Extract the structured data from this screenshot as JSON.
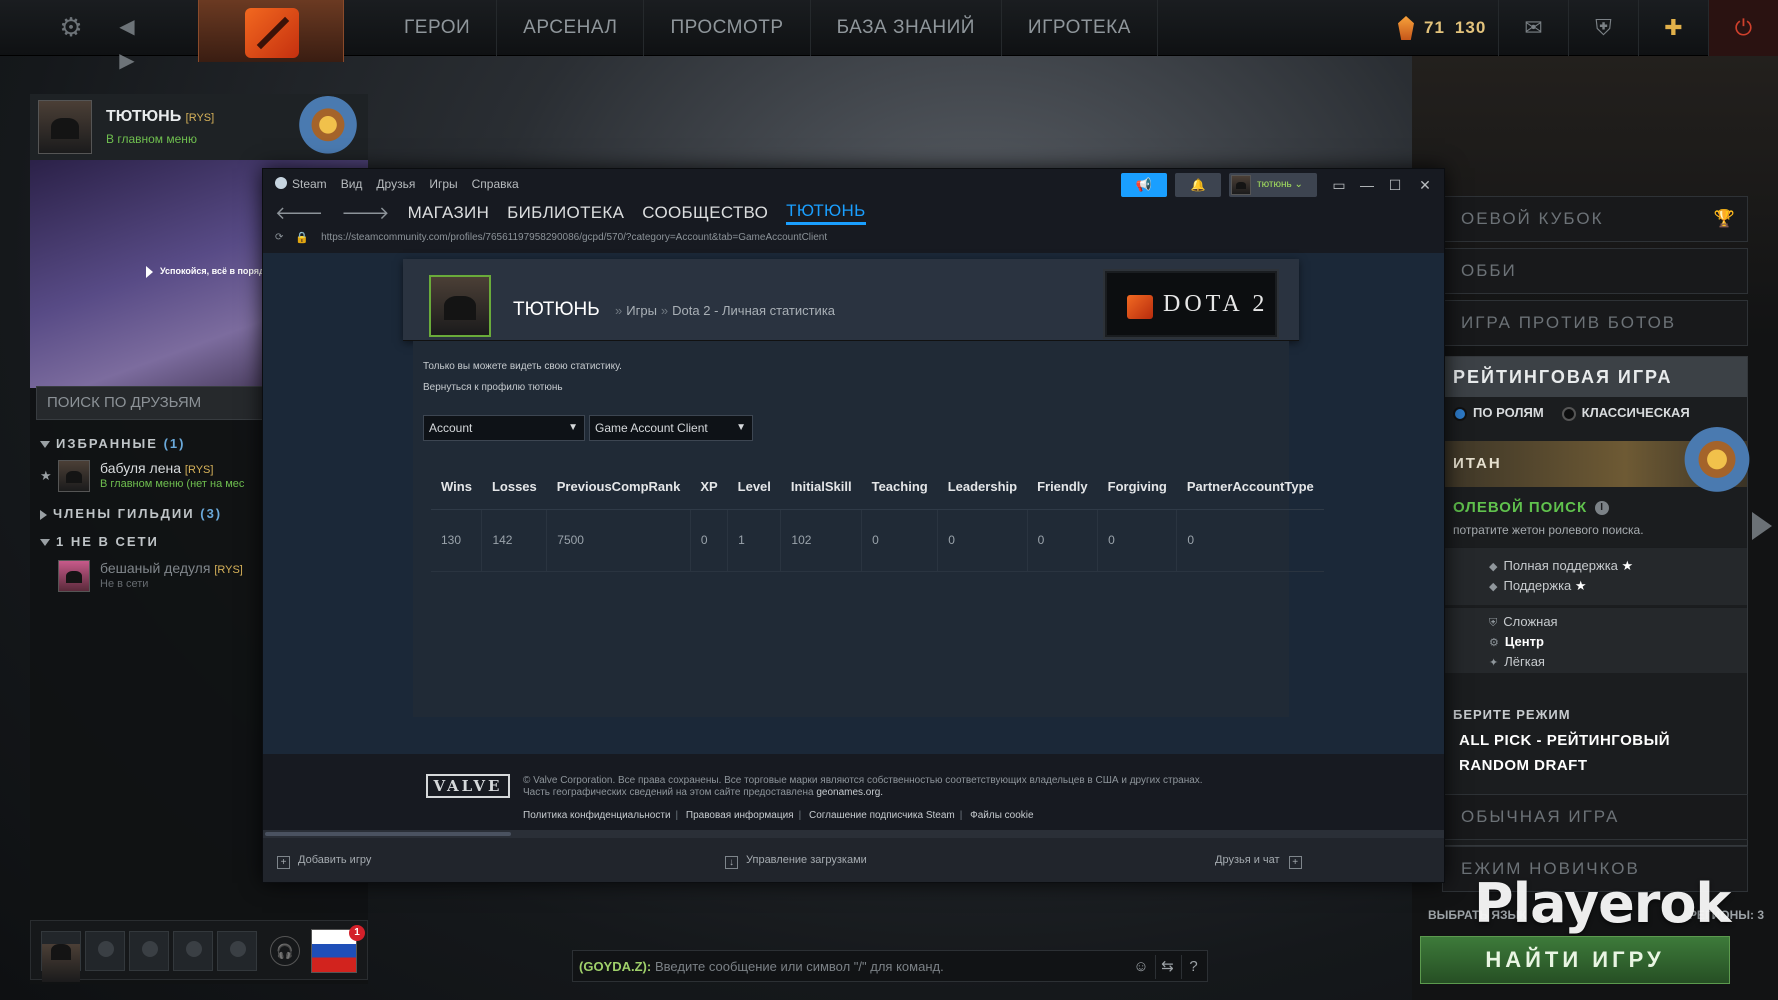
{
  "topbar": {
    "nav": [
      "ГЕРОИ",
      "АРСЕНАЛ",
      "ПРОСМОТР",
      "БАЗА ЗНАНИЙ",
      "ИГРОТЕКА"
    ],
    "currency_a": "71",
    "currency_b": "130"
  },
  "friends": {
    "profile_name": "ТЮТЮНЬ",
    "profile_tag": "[RYS]",
    "profile_status": "В главном меню",
    "promo_text": "Успокойся, всё в порядке",
    "search_placeholder": "ПОИСК ПО ДРУЗЬЯМ",
    "favorites_label": "ИЗБРАННЫЕ",
    "favorites_count": "(1)",
    "guild_label": "ЧЛЕНЫ ГИЛЬДИИ",
    "guild_count": "(3)",
    "offline_label": "1 НЕ В СЕТИ",
    "favorite_friend": {
      "name": "бабуля лена",
      "tag": "[RYS]",
      "status": "В главном меню (нет на мес"
    },
    "offline_friend": {
      "name": "бешаный дедуля",
      "tag": "[RYS]",
      "status": "Не в сети"
    },
    "notif_count": "1"
  },
  "play": {
    "battle_cup": "ОЕВОЙ КУБОК",
    "lobby": "ОББИ",
    "bots": "ИГРА ПРОТИВ БОТОВ",
    "ranked": "РЕЙТИНГОВАЯ ИГРА",
    "role_mode": "ПО РОЛЯМ",
    "classic_mode": "КЛАССИЧЕСКАЯ",
    "rank": "ИТАН",
    "role_search": "ОЛЕВОЙ ПОИСК",
    "role_hint": "потратите жетон ролевого поиска.",
    "roles": [
      "Полная поддержка",
      "Поддержка",
      "Сложная",
      "Центр",
      "Лёгкая"
    ],
    "choose_mode": "БЕРИТЕ РЕЖИМ",
    "mode_1": "ALL PICK - РЕЙТИНГОВЫЙ",
    "mode_2": "RANDOM DRAFT",
    "normal": "ОБЫЧНАЯ ИГРА",
    "newbie": "ЕЖИМ НОВИЧКОВ",
    "lang_left": "ВЫБРАТЬ ЯЗЫК",
    "lang_right": "РЕГИОНЫ: 3",
    "find": "НАЙТИ ИГРУ",
    "watermark": "Playerok"
  },
  "chat": {
    "channel": "(GOYDA.Z):",
    "placeholder": "Введите сообщение или символ \"/\" для команд."
  },
  "steam": {
    "menu": [
      "Steam",
      "Вид",
      "Друзья",
      "Игры",
      "Справка"
    ],
    "username": "тютюнь",
    "tabs": [
      "МАГАЗИН",
      "БИБЛИОТЕКА",
      "СООБЩЕСТВО",
      "ТЮТЮНЬ"
    ],
    "url": "https://steamcommunity.com/profiles/76561197958290086/gcpd/570/?category=Account&tab=GameAccountClient",
    "header_name": "ТЮТЮНЬ",
    "crumb_games": "Игры",
    "crumb_page": "Dota 2 - Личная статистика",
    "dota_badge": "DOTA 2",
    "note": "Только вы можете видеть свою статистику.",
    "back_link": "Вернуться к профилю тютюнь",
    "select_category": "Account",
    "select_tab": "Game Account Client",
    "table": {
      "headers": [
        "Wins",
        "Losses",
        "PreviousCompRank",
        "XP",
        "Level",
        "InitialSkill",
        "Teaching",
        "Leadership",
        "Friendly",
        "Forgiving",
        "PartnerAccountType"
      ],
      "row": [
        "130",
        "142",
        "7500",
        "0",
        "1",
        "102",
        "0",
        "0",
        "0",
        "0",
        "0"
      ]
    },
    "footer_line1": "© Valve Corporation. Все права сохранены. Все торговые марки являются собственностью соответствующих владельцев в США и других странах.",
    "footer_line2": "Часть географических сведений на этом сайте предоставлена",
    "footer_geo": "geonames.org.",
    "footer_links": [
      "Политика конфиденциальности",
      "Правовая информация",
      "Соглашение подписчика Steam",
      "Файлы cookie"
    ],
    "valve": "VALVE",
    "add_game": "Добавить игру",
    "downloads": "Управление загрузками",
    "friends_chat": "Друзья и чат"
  }
}
